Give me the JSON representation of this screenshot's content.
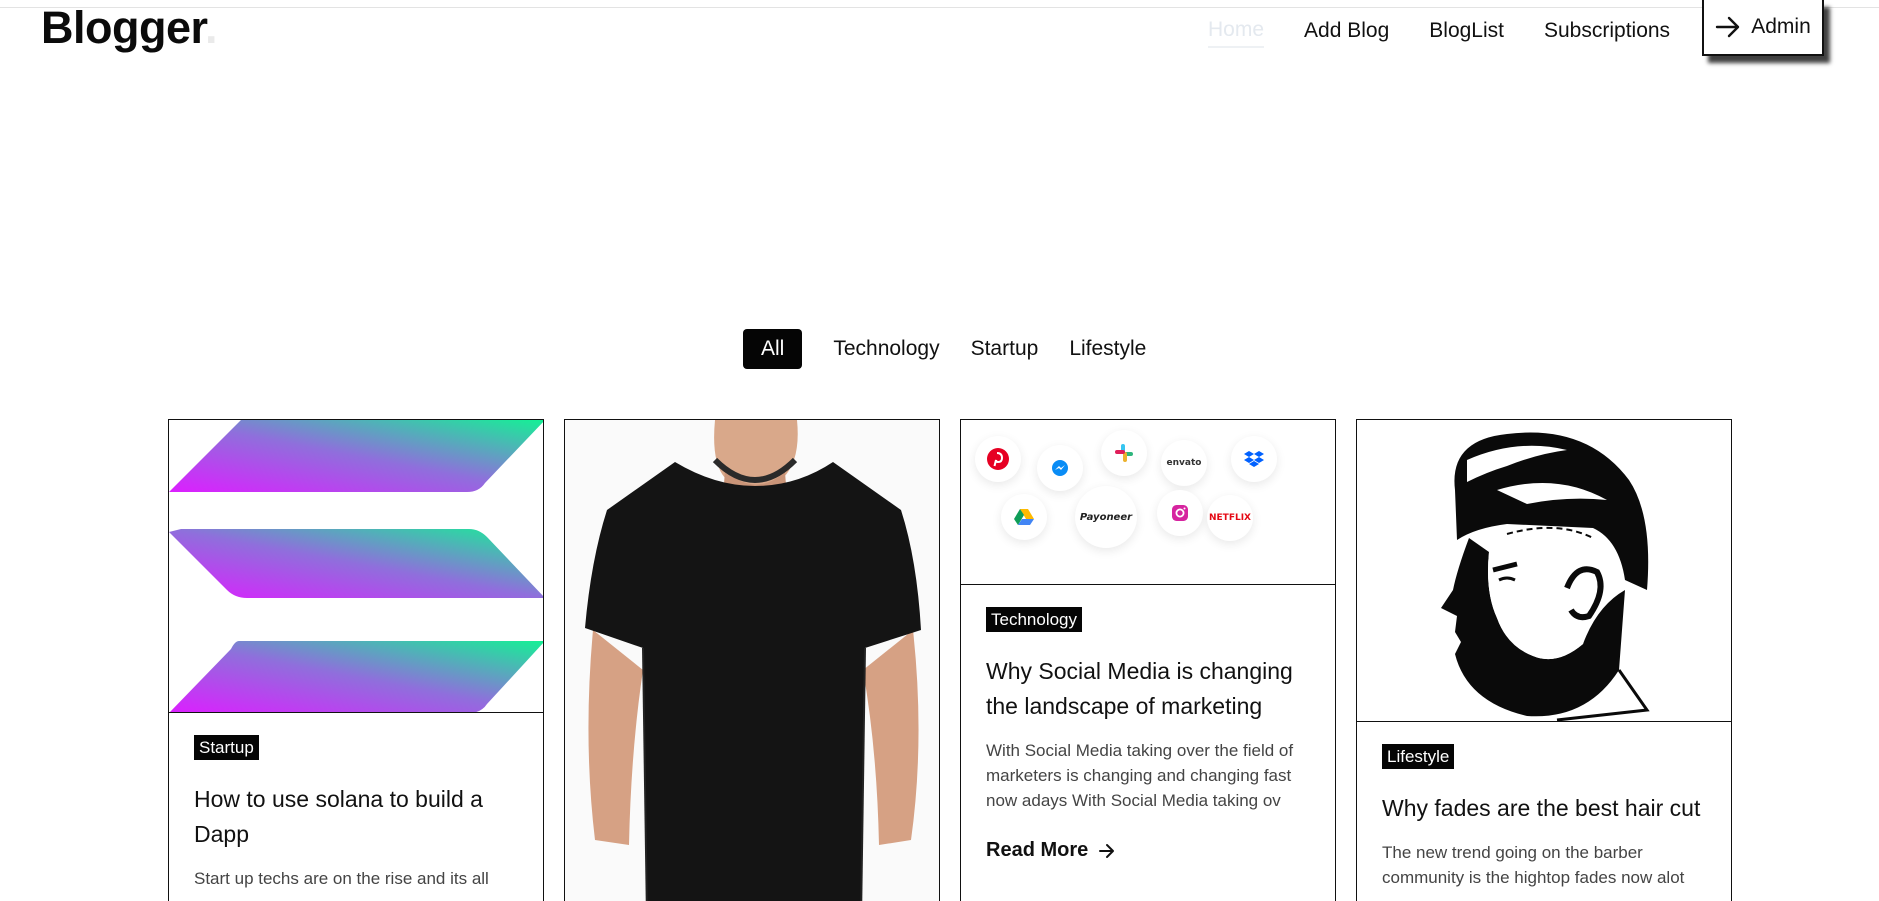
{
  "header": {
    "logo_text": "Blogger",
    "logo_dot": ".",
    "nav": [
      {
        "label": "Home",
        "active": true
      },
      {
        "label": "Add Blog"
      },
      {
        "label": "BlogList"
      },
      {
        "label": "Subscriptions"
      }
    ],
    "admin_label": "Admin"
  },
  "filters": [
    {
      "label": "All",
      "active": true
    },
    {
      "label": "Technology"
    },
    {
      "label": "Startup"
    },
    {
      "label": "Lifestyle"
    }
  ],
  "cards": [
    {
      "tag": "Startup",
      "title": "How to use solana to build a Dapp",
      "excerpt": "Start up techs are on the rise and its all",
      "image": "solana-logo"
    },
    {
      "image": "black-tshirt-photo"
    },
    {
      "tag": "Technology",
      "title": "Why Social Media is changing the landscape of marketing",
      "excerpt": "With Social Media taking over the field of marketers is changing and changing fast now adays With Social Media taking ov",
      "read_more": "Read More",
      "image": "app-logos-collage",
      "app_logos": {
        "envato": "envato",
        "payoneer": "Payoneer",
        "netflix": "NETFLIX"
      }
    },
    {
      "tag": "Lifestyle",
      "title": "Why fades are the best hair cut",
      "excerpt": "The new trend going on the barber community is the hightop fades now alot",
      "image": "fade-haircut-illustration"
    }
  ],
  "colors": {
    "accent": "#050505",
    "solana_teal": "#14f195",
    "solana_purple": "#9945ff",
    "solana_magenta": "#dc1fff"
  }
}
